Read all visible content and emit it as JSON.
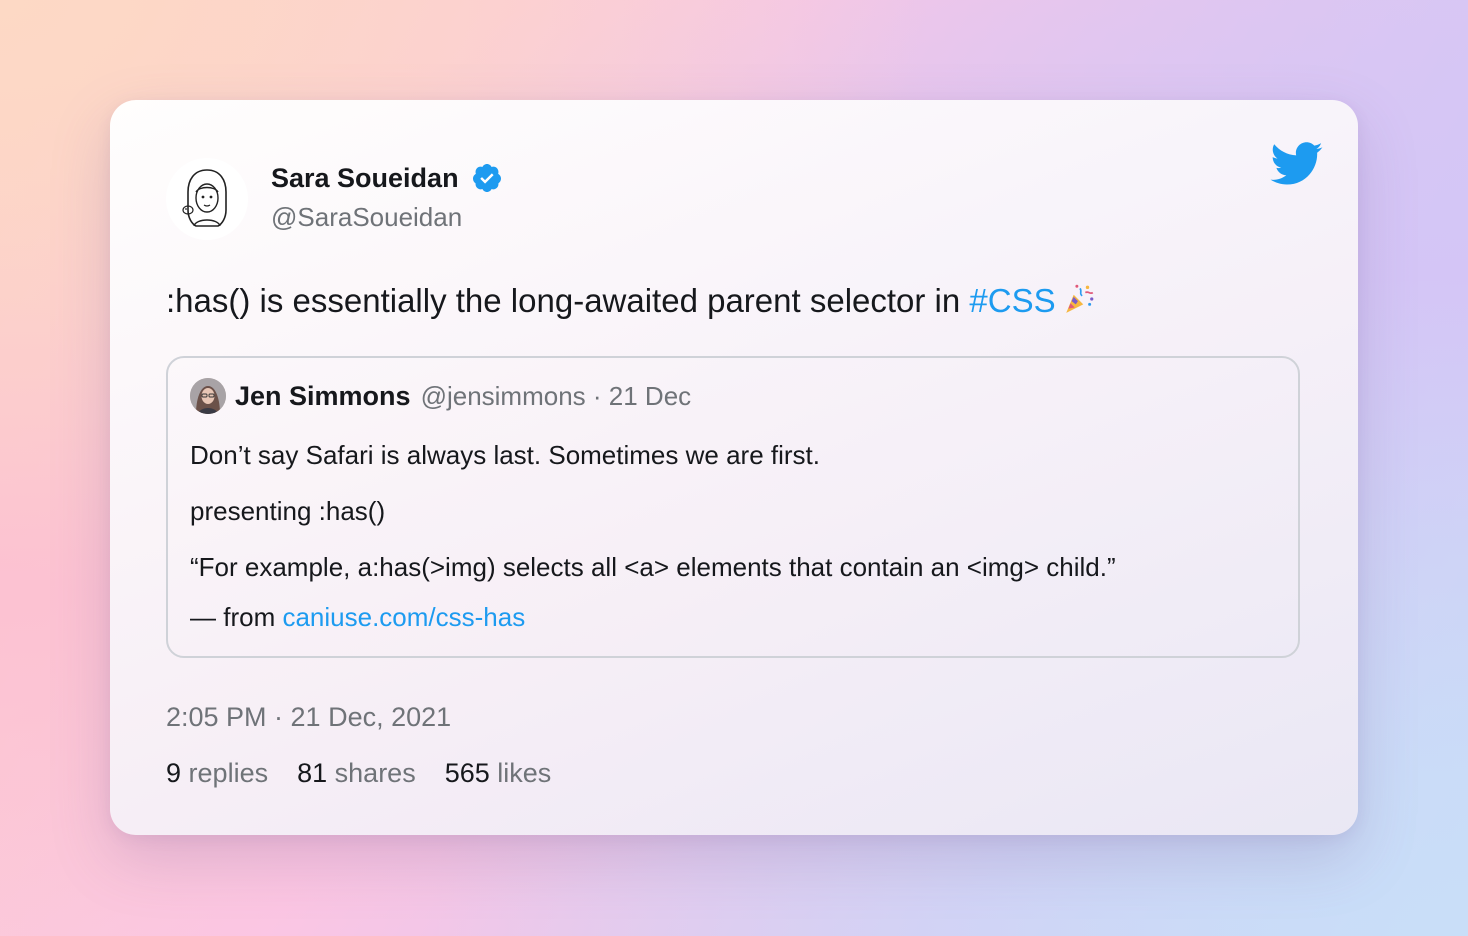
{
  "colors": {
    "accent": "#1d9bf0",
    "text": "#16181c",
    "muted": "#6f7378"
  },
  "tweet": {
    "author": {
      "name": "Sara Soueidan",
      "handle": "@SaraSoueidan",
      "verified": true,
      "avatar_icon": "illustrated-avatar"
    },
    "brand_icon": "twitter-bird-icon",
    "text_before": ":has() is essentially the long-awaited parent selector in ",
    "hashtag": "#CSS",
    "emoji_icon": "party-popper-emoji",
    "quote": {
      "author_name": "Jen Simmons",
      "meta": "@jensimmons · 21 Dec",
      "line1": "Don’t say Safari is always last. Sometimes we are first.",
      "line2": "presenting :has()",
      "line3": "“For example, a:has(>img) selects all <a> elements that contain an <img> child.”",
      "line4_prefix": "— from ",
      "line4_link": "caniuse.com/css-has"
    },
    "timestamp": "2:05 PM · 21 Dec, 2021",
    "stats": {
      "replies_count": "9",
      "replies_label": "replies",
      "shares_count": "81",
      "shares_label": "shares",
      "likes_count": "565",
      "likes_label": "likes"
    }
  }
}
